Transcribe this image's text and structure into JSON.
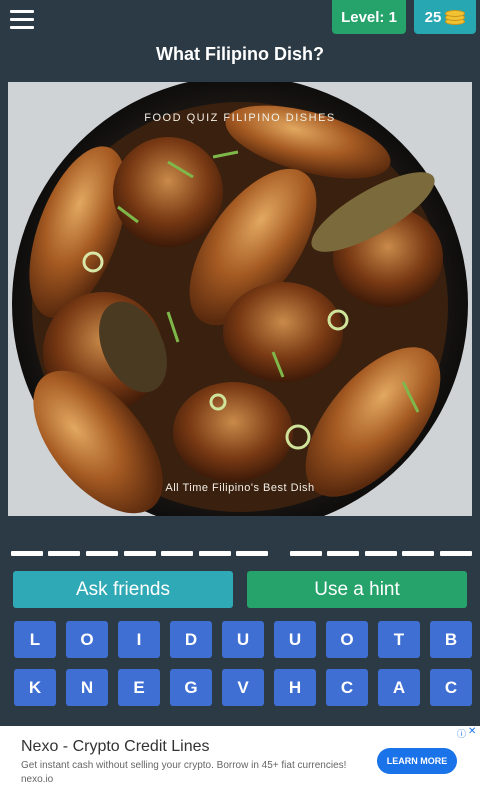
{
  "header": {
    "menu_icon": "hamburger-icon",
    "level_text": "Level: 1",
    "coins": "25",
    "coin_icon": "coin-stack-icon",
    "level_color": "#26a36a",
    "coins_color": "#27a7b2"
  },
  "question": "What Filipino Dish?",
  "photo": {
    "caption_top": "FOOD QUIZ FILIPINO DISHES",
    "caption_bottom": "All Time Filipino's Best Dish"
  },
  "answer_slots": {
    "word_lengths": [
      7,
      5
    ]
  },
  "actions": {
    "ask_label": "Ask friends",
    "hint_label": "Use a hint"
  },
  "letters": {
    "row1": [
      "L",
      "O",
      "I",
      "D",
      "U",
      "U",
      "O",
      "T",
      "B"
    ],
    "row2": [
      "K",
      "N",
      "E",
      "G",
      "V",
      "H",
      "C",
      "A",
      "C"
    ],
    "tile_color": "#3f6fd3"
  },
  "ad": {
    "title": "Nexo - Crypto Credit Lines",
    "text": "Get instant cash without selling your crypto. Borrow in 45+ fiat currencies! nexo.io",
    "cta": "LEARN MORE",
    "info_icon": "ad-info-icon",
    "close_icon": "close-icon"
  }
}
